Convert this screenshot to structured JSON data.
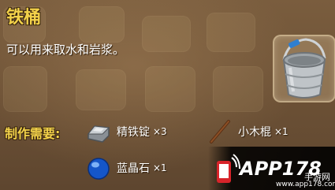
{
  "item": {
    "title": "铁桶",
    "description": "可以用来取水和岩浆。",
    "icon": "iron-bucket-icon"
  },
  "requirements": {
    "label": "制作需要:",
    "materials": [
      {
        "name": "精铁锭",
        "qty": "×3",
        "icon": "iron-ingot-icon"
      },
      {
        "name": "小木棍",
        "qty": "×1",
        "icon": "wooden-stick-icon"
      },
      {
        "name": "蓝晶石",
        "qty": "×1",
        "icon": "blue-crystal-icon"
      }
    ]
  },
  "watermark": {
    "brand": "APP178",
    "sub": "手游网",
    "url": "www.app178.com"
  },
  "colors": {
    "title": "#f3d24a",
    "text": "#ffffff",
    "panel": "#6b5035"
  }
}
